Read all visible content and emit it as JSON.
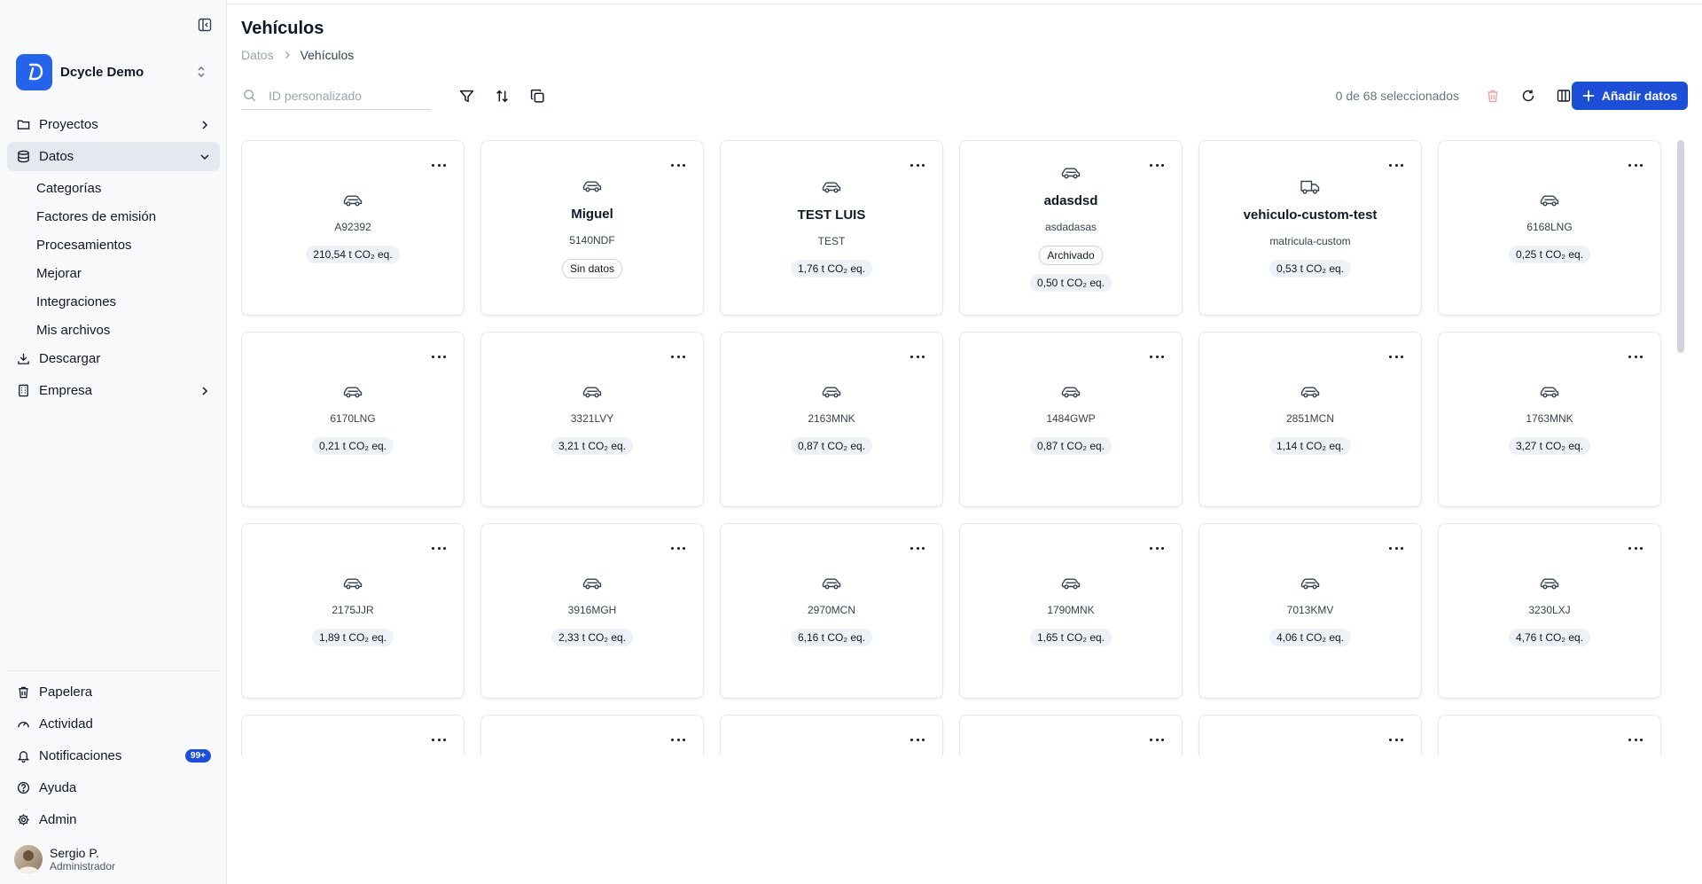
{
  "sidebar": {
    "org_name": "Dcycle Demo",
    "nav": [
      {
        "label": "Proyectos",
        "icon": "folder-icon",
        "expandable": true,
        "active": false
      },
      {
        "label": "Datos",
        "icon": "database-icon",
        "expandable": true,
        "active": true
      }
    ],
    "sub_items": [
      "Categorías",
      "Factores de emisión",
      "Procesamientos",
      "Mejorar",
      "Integraciones",
      "Mis archivos"
    ],
    "nav_after": [
      {
        "label": "Descargar",
        "icon": "download-icon"
      },
      {
        "label": "Empresa",
        "icon": "building-icon"
      }
    ],
    "bottom": [
      {
        "label": "Papelera",
        "icon": "trash-icon"
      },
      {
        "label": "Actividad",
        "icon": "gauge-icon"
      },
      {
        "label": "Notificaciones",
        "icon": "bell-icon",
        "badge": "99+"
      },
      {
        "label": "Ayuda",
        "icon": "help-circle-icon"
      },
      {
        "label": "Admin",
        "icon": "gear-icon"
      }
    ],
    "user": {
      "name": "Sergio P.",
      "role": "Administrador"
    }
  },
  "header": {
    "title": "Vehículos",
    "breadcrumb": {
      "parent": "Datos",
      "current": "Vehículos"
    }
  },
  "toolbar": {
    "search_placeholder": "ID personalizado",
    "selection_count": "0 de 68 seleccionados",
    "add_label": "Añadir datos"
  },
  "cards": [
    {
      "name": "",
      "plate": "A92392",
      "emissions": "210,54 t CO₂ eq.",
      "status": "",
      "icon": "car-icon"
    },
    {
      "name": "Miguel",
      "plate": "5140NDF",
      "emissions": "",
      "status": "Sin datos",
      "icon": "car-icon"
    },
    {
      "name": "TEST LUIS",
      "plate": "TEST",
      "emissions": "1,76 t CO₂ eq.",
      "status": "",
      "icon": "car-icon"
    },
    {
      "name": "adasdsd",
      "plate": "asdadasas",
      "emissions": "0,50 t CO₂ eq.",
      "status": "Archivado",
      "icon": "car-icon"
    },
    {
      "name": "vehiculo-custom-test",
      "plate": "matricula-custom",
      "emissions": "0,53 t CO₂ eq.",
      "status": "",
      "icon": "truck-icon"
    },
    {
      "name": "",
      "plate": "6168LNG",
      "emissions": "0,25 t CO₂ eq.",
      "status": "",
      "icon": "car-icon"
    },
    {
      "name": "",
      "plate": "6170LNG",
      "emissions": "0,21 t CO₂ eq.",
      "status": "",
      "icon": "car-icon"
    },
    {
      "name": "",
      "plate": "3321LVY",
      "emissions": "3,21 t CO₂ eq.",
      "status": "",
      "icon": "car-icon"
    },
    {
      "name": "",
      "plate": "2163MNK",
      "emissions": "0,87 t CO₂ eq.",
      "status": "",
      "icon": "car-icon"
    },
    {
      "name": "",
      "plate": "1484GWP",
      "emissions": "0,87 t CO₂ eq.",
      "status": "",
      "icon": "car-icon"
    },
    {
      "name": "",
      "plate": "2851MCN",
      "emissions": "1,14 t CO₂ eq.",
      "status": "",
      "icon": "car-icon"
    },
    {
      "name": "",
      "plate": "1763MNK",
      "emissions": "3,27 t CO₂ eq.",
      "status": "",
      "icon": "car-icon"
    },
    {
      "name": "",
      "plate": "2175JJR",
      "emissions": "1,89 t CO₂ eq.",
      "status": "",
      "icon": "car-icon"
    },
    {
      "name": "",
      "plate": "3916MGH",
      "emissions": "2,33 t CO₂ eq.",
      "status": "",
      "icon": "car-icon"
    },
    {
      "name": "",
      "plate": "2970MCN",
      "emissions": "6,16 t CO₂ eq.",
      "status": "",
      "icon": "car-icon"
    },
    {
      "name": "",
      "plate": "1790MNK",
      "emissions": "1,65 t CO₂ eq.",
      "status": "",
      "icon": "car-icon"
    },
    {
      "name": "",
      "plate": "7013KMV",
      "emissions": "4,06 t CO₂ eq.",
      "status": "",
      "icon": "car-icon"
    },
    {
      "name": "",
      "plate": "3230LXJ",
      "emissions": "4,76 t CO₂ eq.",
      "status": "",
      "icon": "car-icon"
    },
    {
      "name": "",
      "plate": "",
      "emissions": "",
      "status": "",
      "icon": "car-icon"
    },
    {
      "name": "",
      "plate": "",
      "emissions": "",
      "status": "",
      "icon": "car-icon"
    },
    {
      "name": "",
      "plate": "",
      "emissions": "",
      "status": "",
      "icon": "car-icon"
    },
    {
      "name": "",
      "plate": "",
      "emissions": "",
      "status": "",
      "icon": "car-icon"
    },
    {
      "name": "",
      "plate": "",
      "emissions": "",
      "status": "",
      "icon": "car-icon"
    },
    {
      "name": "",
      "plate": "",
      "emissions": "",
      "status": "",
      "icon": "car-icon"
    }
  ],
  "colors": {
    "accent": "#1d4ed8",
    "logo": "#2563eb",
    "delete": "#f3a6a6"
  }
}
